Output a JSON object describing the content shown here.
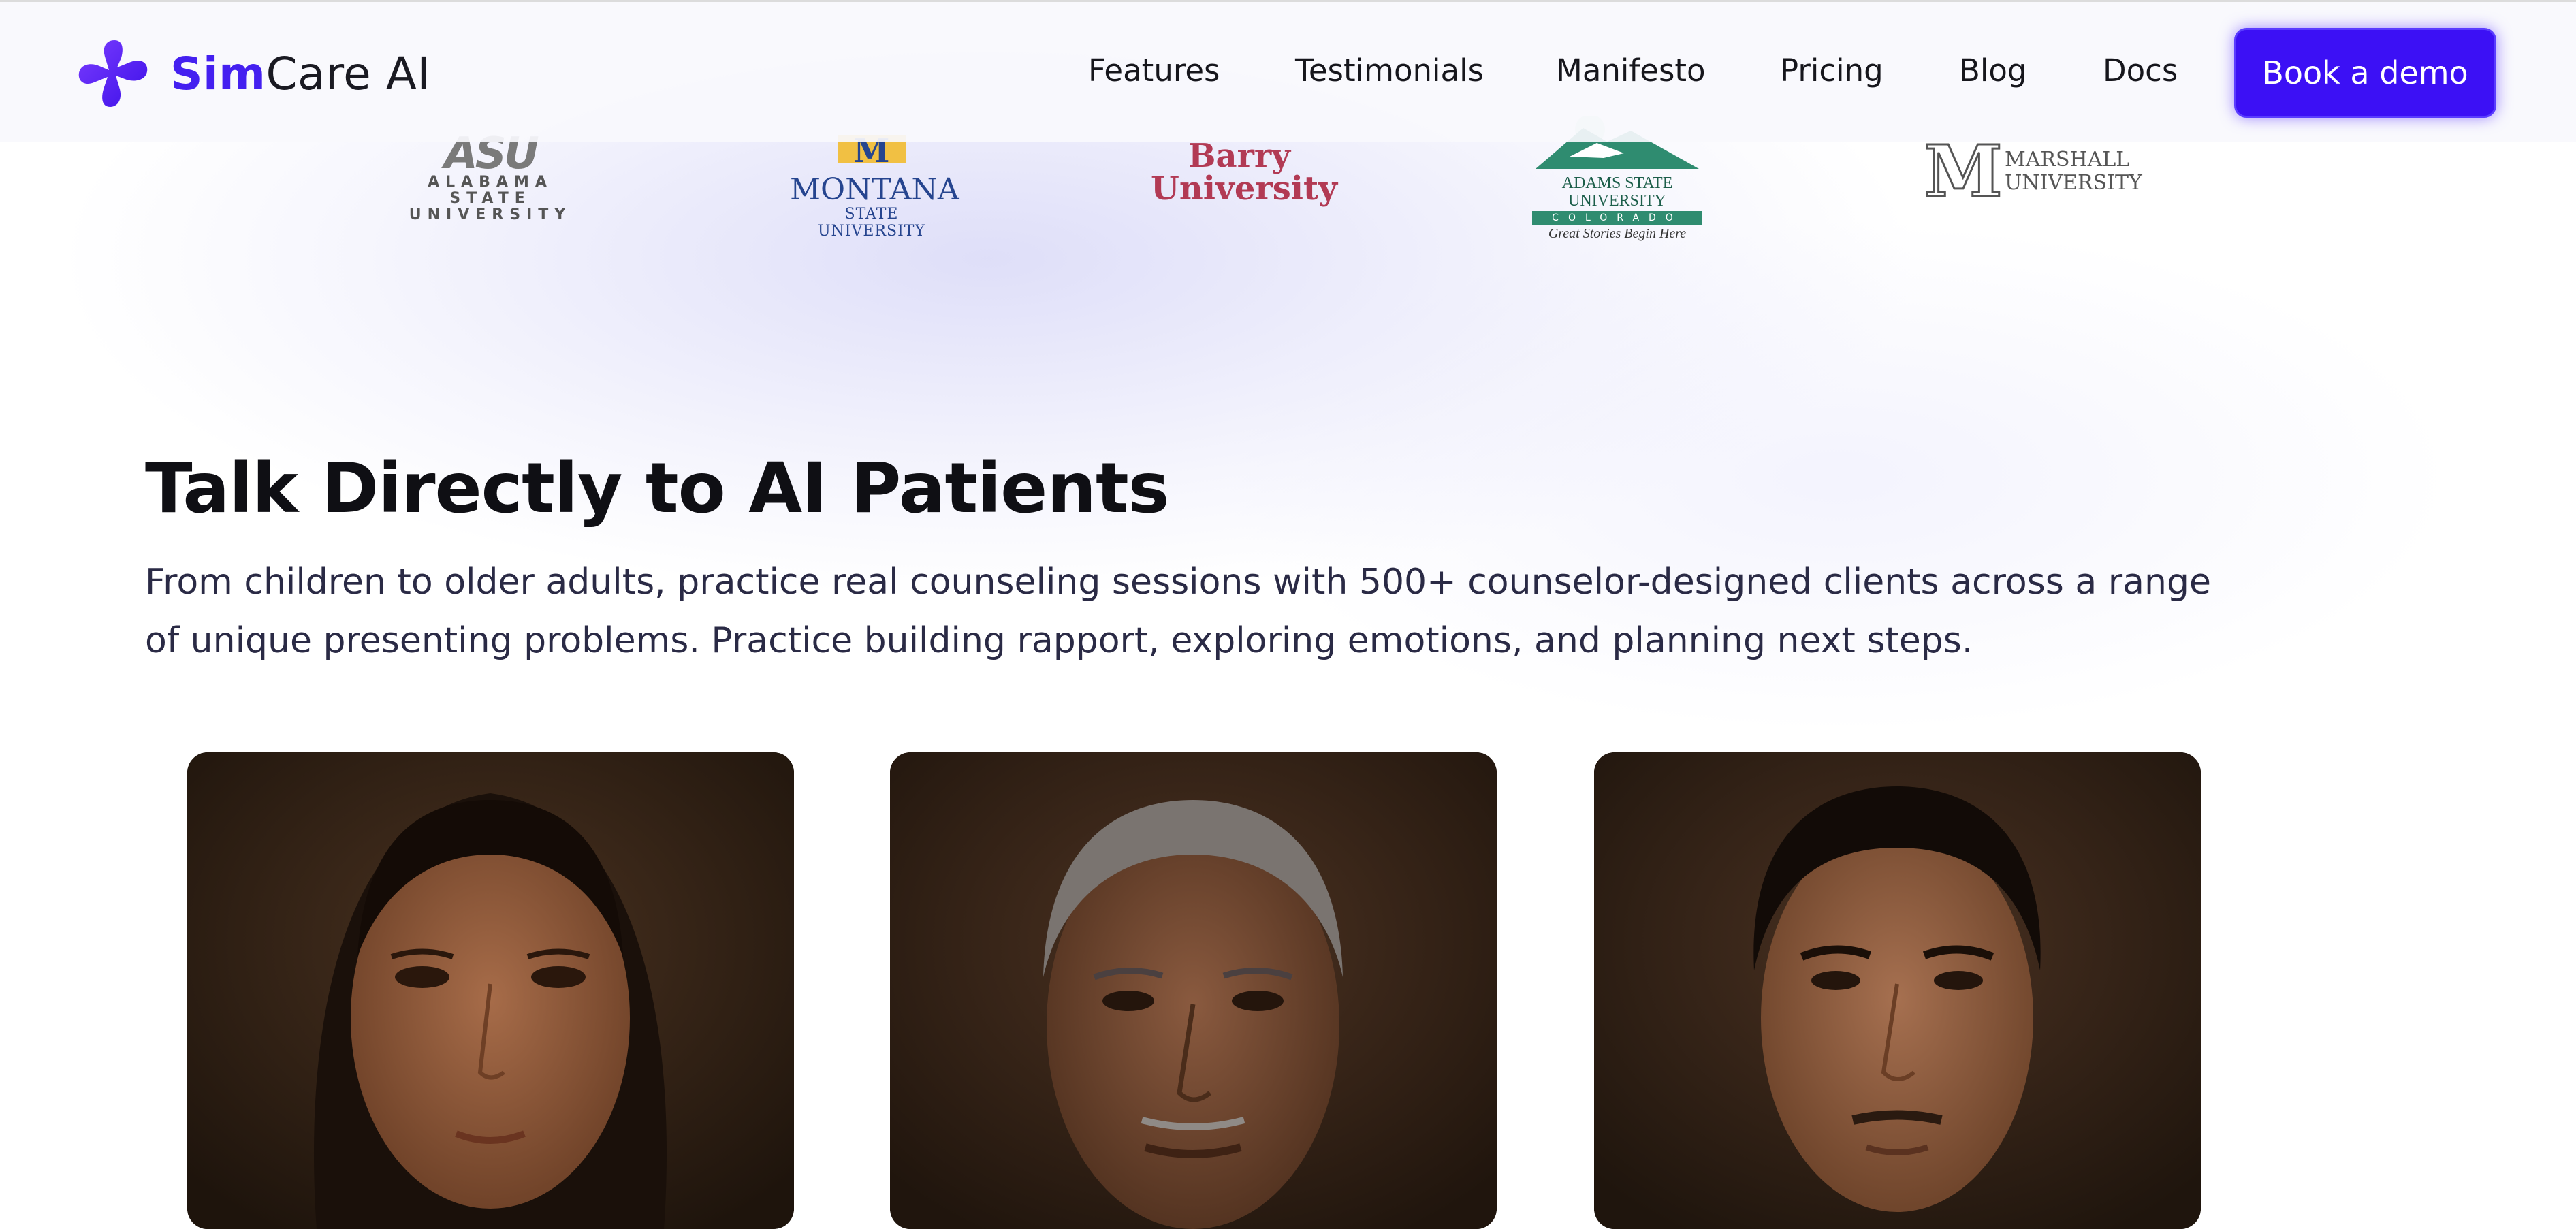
{
  "nav": {
    "brand_part1": "Sim",
    "brand_part2": "Care AI",
    "links": [
      "Features",
      "Testimonials",
      "Manifesto",
      "Pricing",
      "Blog",
      "Docs"
    ],
    "cta": "Book a demo",
    "logo_icon": "plus-cross-icon",
    "accent": "#3c10f5"
  },
  "universities": {
    "asu": {
      "big": "ASU",
      "small": "ALABAMA STATE UNIVERSITY"
    },
    "montana": {
      "mark": "M",
      "big": "MONTANA",
      "small": "STATE UNIVERSITY"
    },
    "barry": {
      "line1": "Barry",
      "line2": "University"
    },
    "adams": {
      "name": "ADAMS STATE UNIVERSITY",
      "band": "COLORADO",
      "tag": "Great Stories Begin Here"
    },
    "marshall": {
      "mark": "M",
      "line1": "MARSHALL",
      "line2": "UNIVERSITY"
    }
  },
  "hero": {
    "title": "Talk Directly to AI Patients",
    "subtitle": "From children to older adults, practice real counseling sessions with 500+ counselor-designed clients across a range of unique presenting problems. Practice building rapport, exploring emotions, and planning next steps."
  },
  "patients": [
    {
      "icon": "young-woman-portrait"
    },
    {
      "icon": "older-man-portrait"
    },
    {
      "icon": "young-man-portrait"
    }
  ]
}
